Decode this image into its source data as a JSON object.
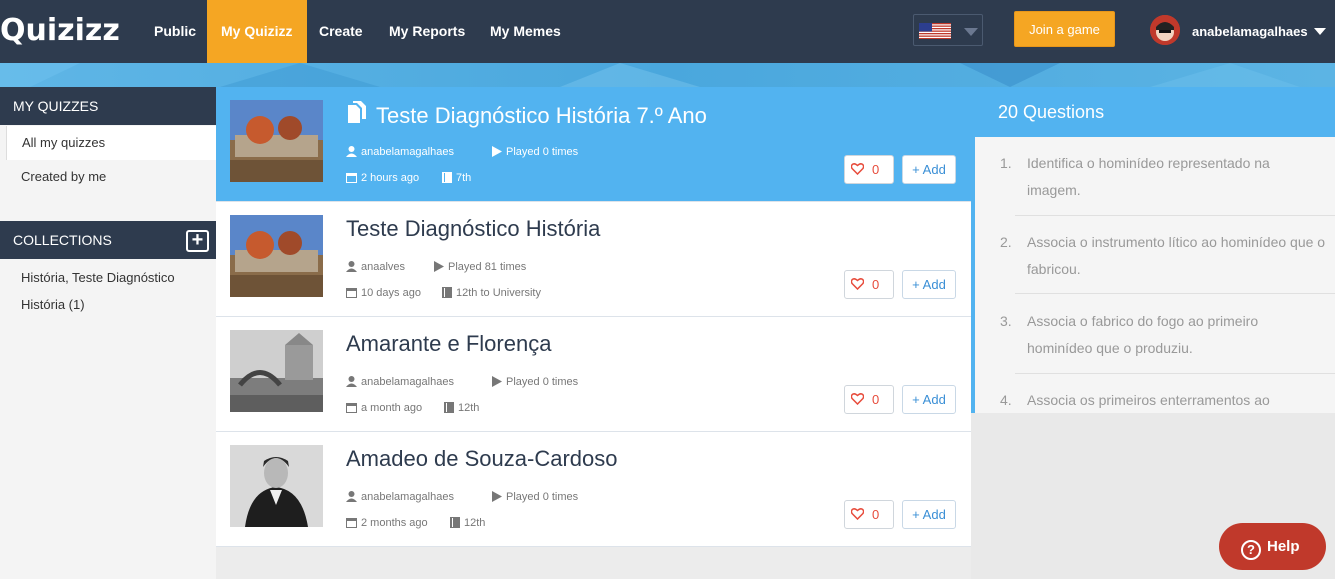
{
  "nav": {
    "logo": "Quizizz",
    "items": [
      {
        "label": "Public",
        "active": false
      },
      {
        "label": "My Quizizz",
        "active": true
      },
      {
        "label": "Create",
        "active": false
      },
      {
        "label": "My Reports",
        "active": false
      },
      {
        "label": "My Memes",
        "active": false
      }
    ],
    "join_label": "Join a game",
    "username": "anabelamagalhaes",
    "language_flag": "us-flag-icon"
  },
  "sidebar": {
    "my_quizzes_header": "MY QUIZZES",
    "items": [
      {
        "label": "All my quizzes",
        "active": true
      },
      {
        "label": "Created by me",
        "active": false
      }
    ],
    "collections_header": "COLLECTIONS",
    "collections": [
      {
        "label": "História, Teste Diagnóstico"
      },
      {
        "label": "História (1)"
      }
    ]
  },
  "quizzes": [
    {
      "title": "Teste Diagnóstico História 7.º Ano",
      "author": "anabelamagalhaes",
      "played": "Played 0 times",
      "time": "2 hours ago",
      "grade": "7th",
      "likes": "0",
      "add": "Add",
      "selected": true
    },
    {
      "title": "Teste Diagnóstico História",
      "author": "anaalves",
      "played": "Played 81 times",
      "time": "10 days ago",
      "grade": "12th to University",
      "likes": "0",
      "add": "Add",
      "selected": false
    },
    {
      "title": "Amarante e Florença",
      "author": "anabelamagalhaes",
      "played": "Played 0 times",
      "time": "a month ago",
      "grade": "12th",
      "likes": "0",
      "add": "Add",
      "selected": false
    },
    {
      "title": "Amadeo de Souza-Cardoso",
      "author": "anabelamagalhaes",
      "played": "Played 0 times",
      "time": "2 months ago",
      "grade": "12th",
      "likes": "0",
      "add": "Add",
      "selected": false
    }
  ],
  "questions_panel": {
    "header": "20 Questions",
    "questions": [
      {
        "num": "1.",
        "text": "Identifica o hominídeo representado na imagem."
      },
      {
        "num": "2.",
        "text": "Associa o instrumento lítico ao hominídeo que o fabricou."
      },
      {
        "num": "3.",
        "text": "Associa o fabrico do fogo ao primeiro hominídeo que o produziu."
      },
      {
        "num": "4.",
        "text": "Associa os primeiros enterramentos ao"
      }
    ]
  },
  "help_label": "Help",
  "colors": {
    "nav_bg": "#2e3b4e",
    "accent_orange": "#f5a623",
    "selected_blue": "#52b3f0",
    "help_red": "#c0392b"
  }
}
